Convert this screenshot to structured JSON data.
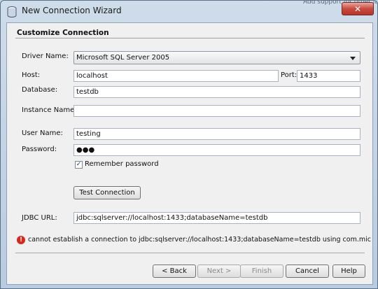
{
  "window": {
    "title": "New Connection Wizard",
    "background_text": "Add support for other langua",
    "close_label": "✕"
  },
  "section_title": "Customize Connection",
  "driver": {
    "label": "Driver Name:",
    "value": "Microsoft SQL Server 2005"
  },
  "host": {
    "label": "Host:",
    "value": "localhost"
  },
  "port": {
    "label": "Port:",
    "value": "1433"
  },
  "database": {
    "label": "Database:",
    "value": "testdb"
  },
  "instance": {
    "label": "Instance Name:",
    "value": ""
  },
  "user": {
    "label": "User Name:",
    "value": "testing"
  },
  "password": {
    "label": "Password:",
    "value": "●●●"
  },
  "remember": {
    "label": "Remember password",
    "checked": true,
    "mark": "✓"
  },
  "test_button": "Test Connection",
  "jdbc": {
    "label": "JDBC URL:",
    "value": "jdbc:sqlserver://localhost:1433;databaseName=testdb"
  },
  "error": {
    "icon": "!",
    "message": "cannot establish a connection to jdbc:sqlserver://localhost:1433;databaseName=testdb using com.microsoft.sqlserv"
  },
  "buttons": {
    "back": "< Back",
    "next": "Next >",
    "finish": "Finish",
    "cancel": "Cancel",
    "help": "Help"
  },
  "colors": {
    "error": "#d9271c",
    "close": "#c94a3f"
  }
}
